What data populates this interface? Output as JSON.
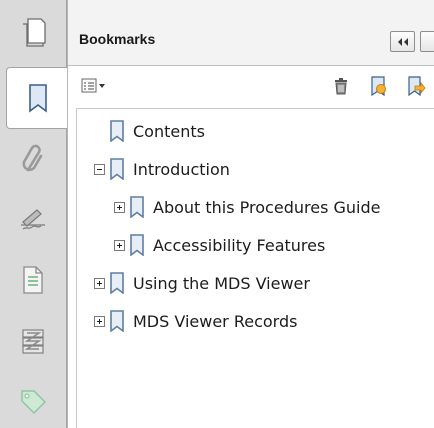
{
  "nav_rail": {
    "items": [
      {
        "icon": "page-thumbnails-icon",
        "active": false
      },
      {
        "icon": "bookmark-icon",
        "active": true
      },
      {
        "icon": "paperclip-icon",
        "active": false
      },
      {
        "icon": "signature-icon",
        "active": false
      },
      {
        "icon": "document-icon",
        "active": false
      },
      {
        "icon": "layers-icon",
        "active": false
      },
      {
        "icon": "tag-icon",
        "active": false
      }
    ]
  },
  "panel": {
    "title": "Bookmarks"
  },
  "toolbar": {
    "options_icon": "options-menu-icon",
    "delete_icon": "trash-icon",
    "new_bookmark_icon": "new-bookmark-icon",
    "move_bookmark_icon": "bookmark-arrow-icon"
  },
  "tree": {
    "nodes": [
      {
        "label": "Contents",
        "level": 0,
        "toggle": "none"
      },
      {
        "label": "Introduction",
        "level": 0,
        "toggle": "minus"
      },
      {
        "label": "About this Procedures Guide",
        "level": 1,
        "toggle": "plus"
      },
      {
        "label": "Accessibility Features",
        "level": 1,
        "toggle": "plus"
      },
      {
        "label": "Using the MDS Viewer",
        "level": 0,
        "toggle": "plus"
      },
      {
        "label": "MDS Viewer Records",
        "level": 0,
        "toggle": "plus"
      }
    ]
  },
  "colors": {
    "rail_bg": "#dadada",
    "bookmark_icon": "#5f7fa3",
    "tag_icon": "#8ec7a0"
  }
}
